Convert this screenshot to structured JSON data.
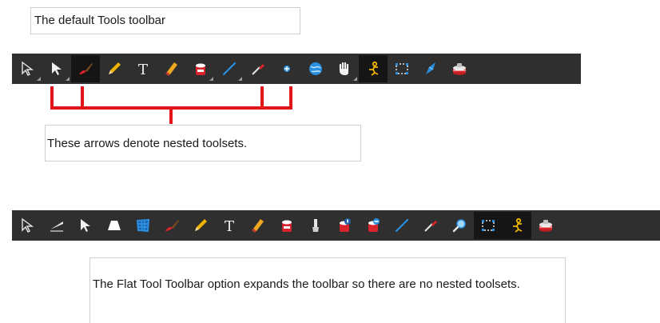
{
  "caption_default": "The default Tools toolbar",
  "caption_nested": "These arrows denote nested toolsets.",
  "caption_flat": "The Flat Tool Toolbar option expands the toolbar so there are no nested toolsets.",
  "colors": {
    "toolbar_bg": "#2f2f2f",
    "active_tool_bg": "#151515",
    "bracket_red": "#e2161a",
    "icon_blue": "#2a8fe0",
    "icon_red": "#d8242a",
    "icon_yellow": "#f0b400"
  },
  "default_toolbar": [
    {
      "icon": "select-arrow-outline-icon",
      "nested": true
    },
    {
      "icon": "contour-editor-arrow-icon",
      "nested": true
    },
    {
      "icon": "brush-icon",
      "active": true
    },
    {
      "icon": "pencil-icon"
    },
    {
      "icon": "text-icon"
    },
    {
      "icon": "eraser-icon"
    },
    {
      "icon": "paint-bucket-icon",
      "nested": true
    },
    {
      "icon": "line-icon",
      "nested": true
    },
    {
      "icon": "dropper-icon"
    },
    {
      "icon": "pivot-icon"
    },
    {
      "icon": "morph-icon"
    },
    {
      "icon": "hand-icon",
      "nested": true
    },
    {
      "icon": "rigging-icon",
      "active": true
    },
    {
      "icon": "rectangle-select-icon"
    },
    {
      "icon": "stroke-icon"
    },
    {
      "icon": "ink-pot-icon"
    }
  ],
  "flat_toolbar": [
    {
      "icon": "select-arrow-outline-icon"
    },
    {
      "icon": "cutter-icon"
    },
    {
      "icon": "contour-editor-arrow-icon"
    },
    {
      "icon": "perspective-icon"
    },
    {
      "icon": "envelope-grid-icon"
    },
    {
      "icon": "brush-icon"
    },
    {
      "icon": "pencil-icon"
    },
    {
      "icon": "text-icon"
    },
    {
      "icon": "eraser-icon"
    },
    {
      "icon": "paint-bucket-icon"
    },
    {
      "icon": "paint-brush-tube-icon"
    },
    {
      "icon": "paint-unpainted-icon"
    },
    {
      "icon": "paint-minus-icon"
    },
    {
      "icon": "line-icon"
    },
    {
      "icon": "dropper-icon"
    },
    {
      "icon": "zoom-icon"
    },
    {
      "icon": "rectangle-select-icon",
      "active": true
    },
    {
      "icon": "rigging-icon",
      "active": true
    },
    {
      "icon": "ink-pot-icon"
    }
  ]
}
